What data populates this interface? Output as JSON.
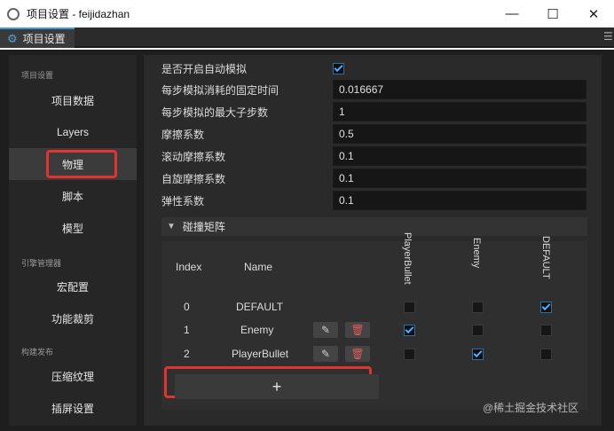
{
  "window": {
    "title": "项目设置 - feijidazhan",
    "minimize_glyph": "—",
    "maximize_glyph": "☐",
    "close_glyph": "✕"
  },
  "tab": {
    "label": "项目设置",
    "icon": "gear-icon"
  },
  "sidebar": {
    "sections": [
      {
        "label": "项目设置"
      },
      {
        "label": "引擎管理器"
      },
      {
        "label": "构建发布"
      }
    ],
    "items": [
      {
        "label": "项目数据"
      },
      {
        "label": "Layers"
      },
      {
        "label": "物理"
      },
      {
        "label": "脚本"
      },
      {
        "label": "模型"
      },
      {
        "label": "宏配置"
      },
      {
        "label": "功能裁剪"
      },
      {
        "label": "压缩纹理"
      },
      {
        "label": "插屏设置"
      }
    ]
  },
  "physics": {
    "auto_simulate_label": "是否开启自动模拟",
    "auto_simulate": true,
    "fixed_time_label": "每步模拟消耗的固定时间",
    "fixed_time": "0.016667",
    "max_substeps_label": "每步模拟的最大子步数",
    "max_substeps": "1",
    "friction_label": "摩擦系数",
    "friction": "0.5",
    "rolling_friction_label": "滚动摩擦系数",
    "rolling_friction": "0.1",
    "spinning_friction_label": "自旋摩擦系数",
    "spinning_friction": "0.1",
    "restitution_label": "弹性系数",
    "restitution": "0.1"
  },
  "collision": {
    "section_label": "碰撞矩阵",
    "col_index": "Index",
    "col_name": "Name",
    "columns": [
      "PlayerBullet",
      "Enemy",
      "DEFAULT"
    ],
    "rows": [
      {
        "index": "0",
        "name": "DEFAULT",
        "checks": [
          false,
          false,
          true
        ]
      },
      {
        "index": "1",
        "name": "Enemy",
        "checks": [
          true,
          false,
          false
        ]
      },
      {
        "index": "2",
        "name": "PlayerBullet",
        "checks": [
          false,
          true,
          false
        ]
      }
    ],
    "add_label": "+"
  },
  "watermark": "@稀土掘金技术社区"
}
